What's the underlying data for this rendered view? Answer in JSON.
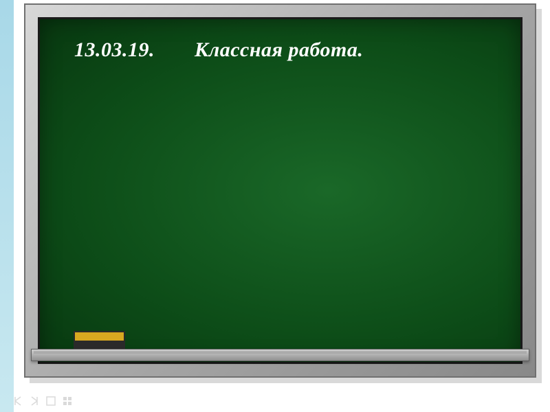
{
  "chalkboard": {
    "date": "13.03.19.",
    "title": "Классная работа."
  }
}
